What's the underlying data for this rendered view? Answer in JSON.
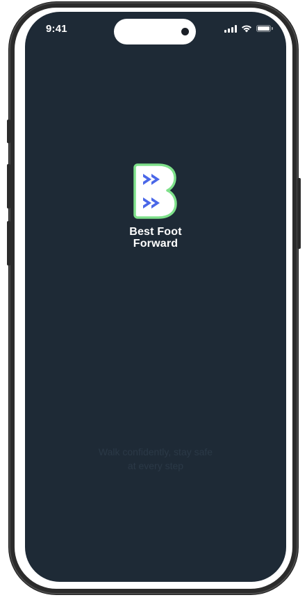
{
  "status_bar": {
    "time": "9:41",
    "icons": [
      "signal-icon",
      "wifi-icon",
      "battery-icon"
    ]
  },
  "splash": {
    "logo_icon": "double-chevron-b-logo",
    "brand_line_1": "Best Foot",
    "brand_line_2": "Forward",
    "tagline_line_1": "Walk confidently, stay safe",
    "tagline_line_2": "at every step"
  },
  "colors": {
    "background": "#1e2a36",
    "logo_outline": "#7ee08a",
    "logo_fill": "#ffffff",
    "chevron": "#4a67e8"
  }
}
